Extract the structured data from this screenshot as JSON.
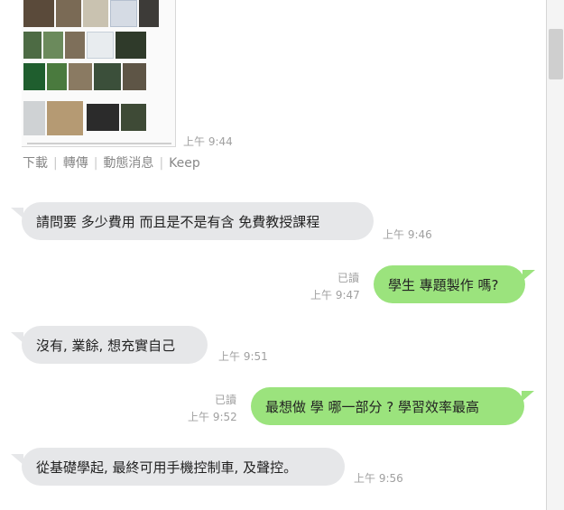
{
  "image_message": {
    "time": "上午 9:44"
  },
  "actions": {
    "download": "下載",
    "forward": "轉傳",
    "timeline": "動態消息",
    "keep": "Keep"
  },
  "messages": [
    {
      "side": "received",
      "text": "請問要 多少費用 而且是不是有含 免費教授課程",
      "time": "上午 9:46"
    },
    {
      "side": "sent",
      "text": "學生 專題製作 嗎?",
      "read": "已讀",
      "time": "上午 9:47"
    },
    {
      "side": "received",
      "text": "沒有, 業餘, 想充實自己",
      "time": "上午 9:51"
    },
    {
      "side": "sent",
      "text": "最想做 學 哪一部分 ? 學習效率最高",
      "read": "已讀",
      "time": "上午 9:52"
    },
    {
      "side": "received",
      "text": "從基礎學起, 最終可用手機控制車, 及聲控。",
      "time": "上午 9:56"
    }
  ],
  "colors": {
    "sent_bubble": "#9be37d",
    "received_bubble": "#e6e7e9",
    "meta_text": "#a0a0a0"
  }
}
